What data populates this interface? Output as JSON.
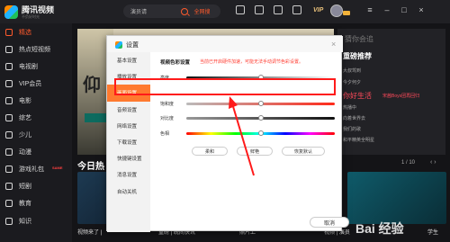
{
  "app": {
    "logo_main": "腾讯视频",
    "logo_sub": "不负好时光"
  },
  "search": {
    "value": "演员请",
    "button_label": "全网搜"
  },
  "topbar": {
    "vip_label": "VIP"
  },
  "sidebar": {
    "items": [
      {
        "label": "精选",
        "active": true
      },
      {
        "label": "热点短视频"
      },
      {
        "label": "电视剧"
      },
      {
        "label": "VIP会员"
      },
      {
        "label": "电影"
      },
      {
        "label": "综艺"
      },
      {
        "label": "少儿"
      },
      {
        "label": "动漫"
      },
      {
        "label": "游戏礼包",
        "badge": "SAME"
      },
      {
        "label": "短剧"
      },
      {
        "label": "教育"
      },
      {
        "label": "知识"
      }
    ]
  },
  "right_panel": {
    "title": "猜你会追",
    "subtitle": "重磅推荐",
    "items": [
      "大叔驾到",
      "今夕何夕",
      "你好生活",
      "热播中",
      "向着世界去",
      "我们的歌",
      "和平精英全明星"
    ],
    "highlight": "你好生活",
    "highlight_suffix": "宋茜Boys团再回归"
  },
  "section": {
    "title": "今日热",
    "pager": "1 / 10"
  },
  "thumbs": [
    {
      "caption": "视频来了 |"
    },
    {
      "caption": "重磅 | 晚间快讯"
    },
    {
      "caption": "照片上"
    },
    {
      "caption": "视频 | 演员"
    },
    {
      "caption": "学生"
    }
  ],
  "watermark": "Bai 经验",
  "dialog": {
    "title": "设置",
    "close": "×",
    "nav": [
      "基本设置",
      "播放设置",
      "画面设置",
      "音频设置",
      "网络设置",
      "下载设置",
      "快捷键设置",
      "消息设置",
      "自动关机"
    ],
    "active_index": 2,
    "main_title": "视频色彩设置",
    "hint": "当前已开启硬件加速，可能无法手动调节色彩设置。",
    "sliders": [
      {
        "label": "亮度",
        "value": 50
      },
      {
        "label": "饱和度",
        "value": 50
      },
      {
        "label": "对比度",
        "value": 50
      },
      {
        "label": "色相",
        "value": 50
      }
    ],
    "buttons": [
      "柔和",
      "鲜艳",
      "恢复默认"
    ],
    "cancel_label": "取消"
  }
}
